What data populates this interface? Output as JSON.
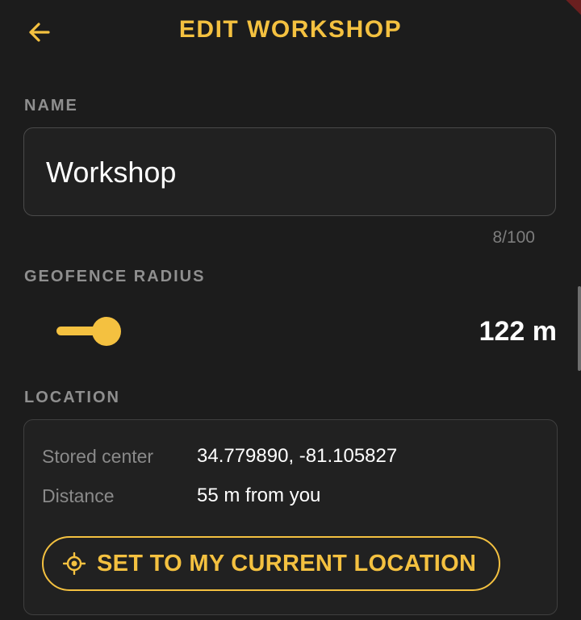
{
  "app_bar": {
    "title": "EDIT WORKSHOP",
    "back_icon": "arrow-left-icon"
  },
  "colors": {
    "accent": "#f4c140",
    "background": "#1c1c1c",
    "surface": "#212121",
    "muted_text": "#8f8f8f"
  },
  "name_section": {
    "label": "NAME",
    "value": "Workshop",
    "counter": "8/100"
  },
  "radius_section": {
    "label": "GEOFENCE RADIUS",
    "value_text": "122 m",
    "slider_fraction": 0.1
  },
  "location_section": {
    "label": "LOCATION",
    "rows": [
      {
        "label": "Stored center",
        "value": "34.779890, -81.105827"
      },
      {
        "label": "Distance",
        "value": "55 m from you"
      }
    ],
    "button_label": "SET TO MY CURRENT LOCATION",
    "button_icon": "gps-target-icon"
  }
}
